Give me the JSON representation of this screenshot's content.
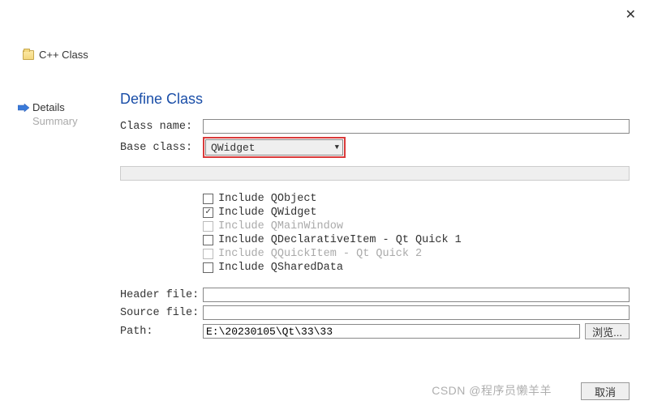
{
  "window": {
    "title": "C++ Class"
  },
  "sidebar": {
    "items": [
      {
        "label": "Details",
        "active": true
      },
      {
        "label": "Summary",
        "active": false
      }
    ]
  },
  "main": {
    "heading": "Define Class",
    "fields": {
      "class_name_label": "Class name:",
      "class_name_value": "",
      "base_class_label": "Base class:",
      "base_class_value": "QWidget",
      "header_file_label": "Header file:",
      "header_file_value": "",
      "source_file_label": "Source file:",
      "source_file_value": "",
      "path_label": "Path:",
      "path_value": "E:\\20230105\\Qt\\33\\33",
      "browse_label": "浏览..."
    },
    "checks": [
      {
        "label": "Include QObject",
        "checked": false,
        "disabled": false
      },
      {
        "label": "Include QWidget",
        "checked": true,
        "disabled": false
      },
      {
        "label": "Include QMainWindow",
        "checked": false,
        "disabled": true
      },
      {
        "label": "Include QDeclarativeItem - Qt Quick 1",
        "checked": false,
        "disabled": false
      },
      {
        "label": "Include QQuickItem - Qt Quick 2",
        "checked": false,
        "disabled": true
      },
      {
        "label": "Include QSharedData",
        "checked": false,
        "disabled": false
      }
    ]
  },
  "footer": {
    "cancel": "取消"
  },
  "watermark": "CSDN @程序员懒羊羊"
}
